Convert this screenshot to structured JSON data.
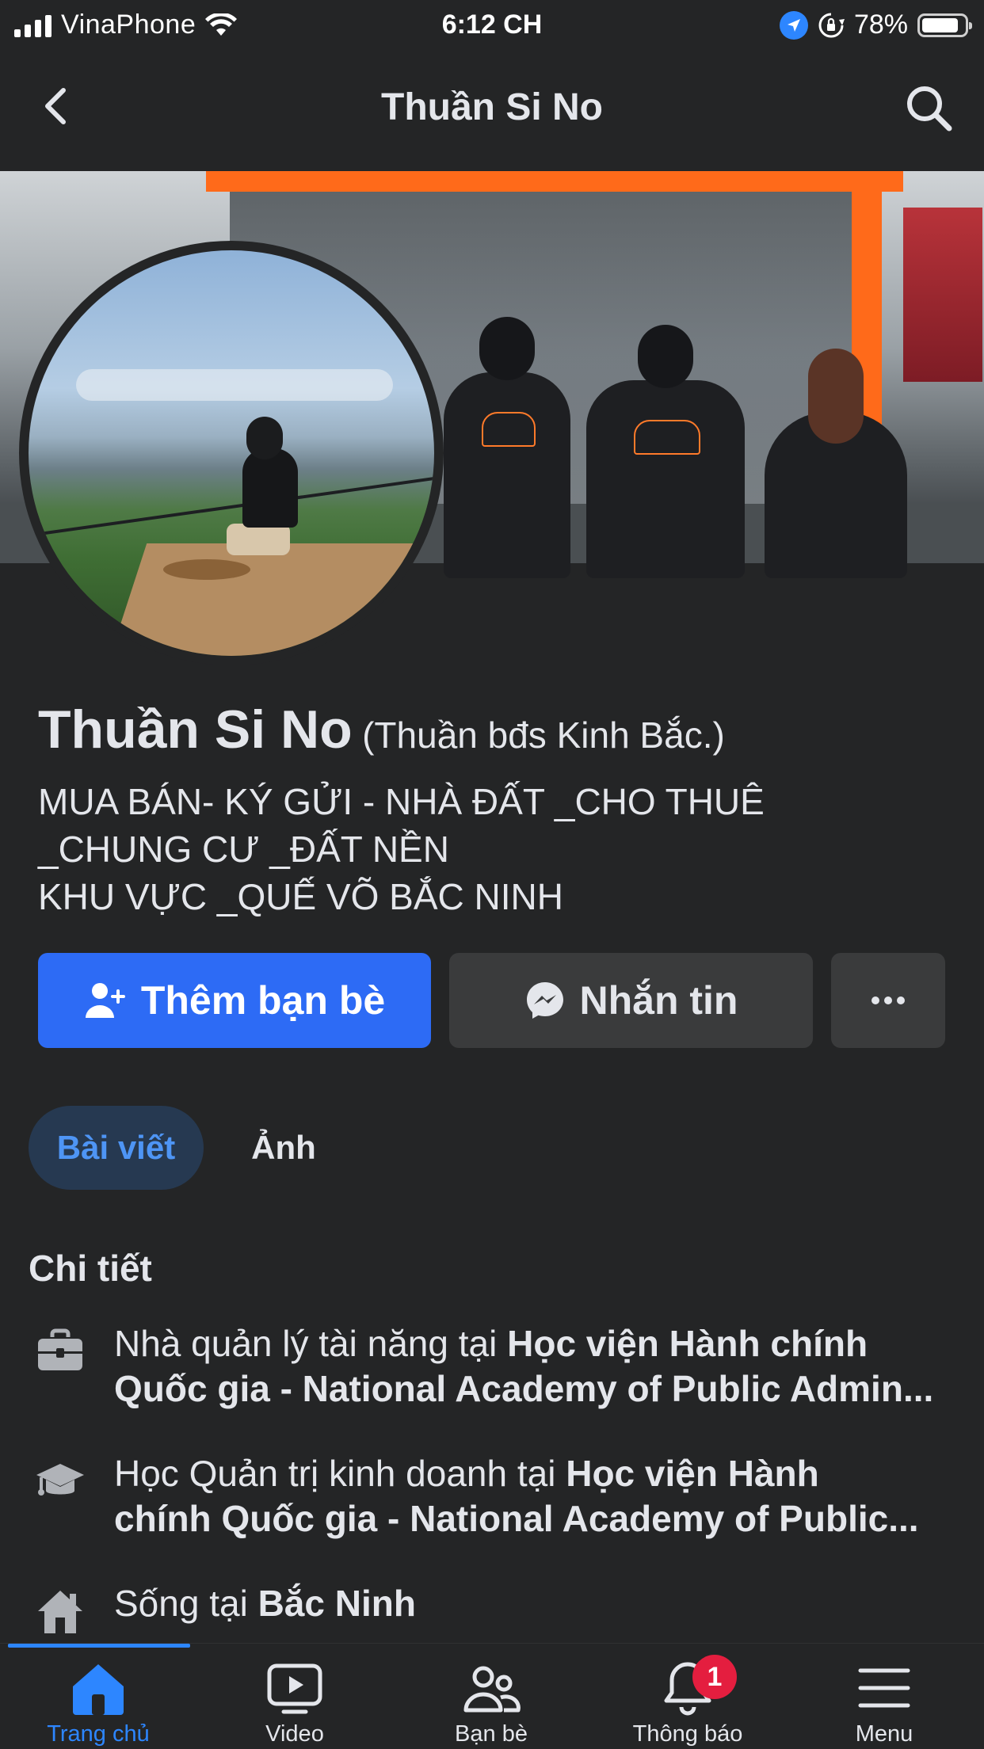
{
  "status_bar": {
    "carrier": "VinaPhone",
    "time": "6:12 CH",
    "battery": "78%",
    "battery_level": 0.78
  },
  "header": {
    "title": "Thuần Si No",
    "back_icon": "chevron-left-icon",
    "search_icon": "search-icon"
  },
  "profile": {
    "name": "Thuần Si No",
    "alternate_name": "(Thuần bđs Kinh Bắc.)",
    "bio": [
      "MUA BÁN- KÝ GỬI - NHÀ ĐẤT _CHO THUÊ",
      "_CHUNG  CƯ _ĐẤT NỀN",
      "KHU VỰC _QUẾ VÕ BẮC NINH"
    ]
  },
  "actions": {
    "add_friend": "Thêm bạn bè",
    "message": "Nhắn tin",
    "more": "···"
  },
  "tabs": [
    {
      "label": "Bài viết",
      "active": true
    },
    {
      "label": "Ảnh",
      "active": false
    }
  ],
  "details": {
    "title": "Chi tiết",
    "work": {
      "prefix": "Nhà quản lý tài năng tại ",
      "place_line1": "Học viện Hành chính",
      "place_line2": "Quốc gia - National Academy of Public Admin..."
    },
    "education": {
      "prefix": "Học Quản trị kinh doanh tại ",
      "place_line1": "Học viện Hành",
      "place_line2": "chính Quốc gia - National Academy of Public..."
    },
    "lives_in": {
      "prefix": "Sống tại ",
      "place": "Bắc Ninh"
    }
  },
  "bottom_nav": {
    "home": "Trang chủ",
    "video": "Video",
    "friends": "Bạn bè",
    "notifications": "Thông báo",
    "notifications_badge": "1",
    "menu": "Menu"
  },
  "colors": {
    "background": "#242526",
    "primary_blue": "#2d6bf5",
    "active_tab_text": "#4e95f5",
    "badge_red": "#e41e3f",
    "cover_frame_orange": "#ff6a1a"
  }
}
